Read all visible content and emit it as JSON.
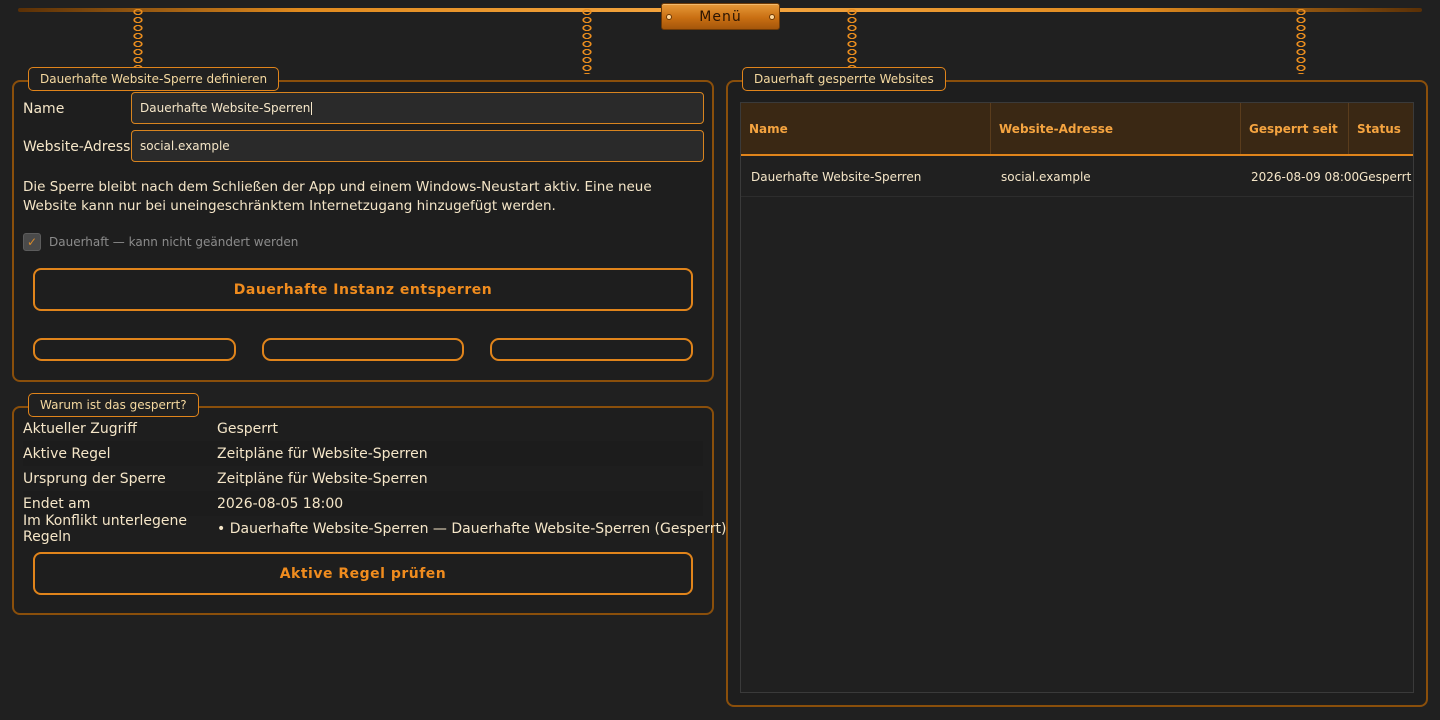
{
  "menu": {
    "label": "Menü"
  },
  "define_panel": {
    "legend": "Dauerhafte Website-Sperre definieren",
    "name_label": "Name",
    "name_value": "Dauerhafte Website-Sperren",
    "address_label": "Website-Adresse",
    "address_value": "social.example",
    "info": "Die Sperre bleibt nach dem Schließen der App und einem Windows-Neustart aktiv. Eine neue Website kann nur bei uneingeschränktem Internetzugang hinzugefügt werden.",
    "checkbox_label": "Dauerhaft — kann nicht geändert werden",
    "checkbox_checked": true,
    "unlock_button": "Dauerhafte Instanz entsperren"
  },
  "why_panel": {
    "legend": "Warum ist das gesperrt?",
    "rows": [
      {
        "key": "Aktueller Zugriff",
        "value": "Gesperrt"
      },
      {
        "key": "Aktive Regel",
        "value": "Zeitpläne für Website-Sperren"
      },
      {
        "key": "Ursprung der Sperre",
        "value": "Zeitpläne für Website-Sperren"
      },
      {
        "key": "Endet am",
        "value": "2026-08-05 18:00"
      },
      {
        "key": "Im Konflikt unterlegene Regeln",
        "value": "• Dauerhafte Website-Sperren — Dauerhafte Website-Sperren (Gesperrt)"
      }
    ],
    "check_button": "Aktive Regel prüfen"
  },
  "blocked_panel": {
    "legend": "Dauerhaft gesperrte Websites",
    "columns": [
      "Name",
      "Website-Adresse",
      "Gesperrt seit",
      "Status"
    ],
    "rows": [
      [
        "Dauerhafte Website-Sperren",
        "social.example",
        "2026-08-09 08:00",
        "Gesperrt"
      ]
    ]
  }
}
